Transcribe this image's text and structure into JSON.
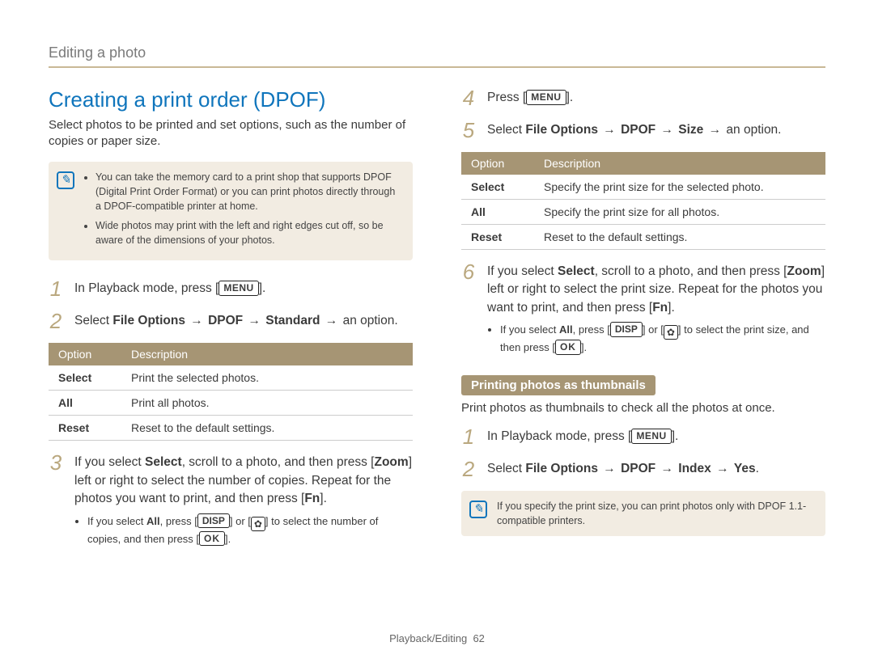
{
  "header": "Editing a photo",
  "title": "Creating a print order (DPOF)",
  "intro": "Select photos to be printed and set options, such as the number of copies or paper size.",
  "note1": {
    "items": [
      "You can take the memory card to a print shop that supports DPOF (Digital Print Order Format) or you can print photos directly through a DPOF-compatible printer at home.",
      "Wide photos may print with the left and right edges cut off, so be aware of the dimensions of your photos."
    ]
  },
  "keys": {
    "menu": "MENU",
    "zoom": "Zoom",
    "fn": "Fn",
    "disp": "DISP",
    "ok": "OK"
  },
  "left": {
    "step1": {
      "num": "1",
      "prefix": "In Playback mode, press [",
      "suffix": "]."
    },
    "step2": {
      "num": "2",
      "lead": "Select ",
      "path1": "File Options",
      "path2": "DPOF",
      "path3": "Standard",
      "tail": " an option."
    },
    "table": {
      "h1": "Option",
      "h2": "Description",
      "rows": [
        {
          "o": "Select",
          "d": "Print the selected photos."
        },
        {
          "o": "All",
          "d": "Print all photos."
        },
        {
          "o": "Reset",
          "d": "Reset to the default settings."
        }
      ]
    },
    "step3": {
      "num": "3",
      "seg1": "If you select ",
      "b1": "Select",
      "seg2": ", scroll to a photo, and then press [",
      "seg3": "] left or right to select the number of copies. Repeat for the photos you want to print, and then press [",
      "seg4": "]."
    },
    "step3bullet": {
      "seg1": "If you select ",
      "b1": "All",
      "seg2": ", press [",
      "seg3": "] or [",
      "seg4": "] to select the number of copies, and then press [",
      "seg5": "]."
    }
  },
  "right": {
    "step4": {
      "num": "4",
      "seg1": "Press [",
      "seg2": "]."
    },
    "step5": {
      "num": "5",
      "lead": "Select ",
      "path1": "File Options",
      "path2": "DPOF",
      "path3": "Size",
      "tail": " an option."
    },
    "table": {
      "h1": "Option",
      "h2": "Description",
      "rows": [
        {
          "o": "Select",
          "d": "Specify the print size for the selected photo."
        },
        {
          "o": "All",
          "d": "Specify the print size for all photos."
        },
        {
          "o": "Reset",
          "d": "Reset to the default settings."
        }
      ]
    },
    "step6": {
      "num": "6",
      "seg1": "If you select ",
      "b1": "Select",
      "seg2": ", scroll to a photo, and then press [",
      "seg3": "] left or right to select the print size. Repeat for the photos you want to print, and then press [",
      "seg4": "]."
    },
    "step6bullet": {
      "seg1": "If you select ",
      "b1": "All",
      "seg2": ", press [",
      "seg3": "] or [",
      "seg4": "] to select the print size, and then press [",
      "seg5": "]."
    },
    "subheading": "Printing photos as thumbnails",
    "subintro": "Print photos as thumbnails to check all the photos at once.",
    "tstep1": {
      "num": "1",
      "prefix": "In Playback mode, press [",
      "suffix": "]."
    },
    "tstep2": {
      "num": "2",
      "lead": "Select ",
      "path1": "File Options",
      "path2": "DPOF",
      "path3": "Index",
      "path4": "Yes",
      "tail": "."
    },
    "note2": "If you specify the print size, you can print photos only with DPOF 1.1-compatible printers."
  },
  "footer": {
    "section": "Playback/Editing",
    "page": "62"
  }
}
